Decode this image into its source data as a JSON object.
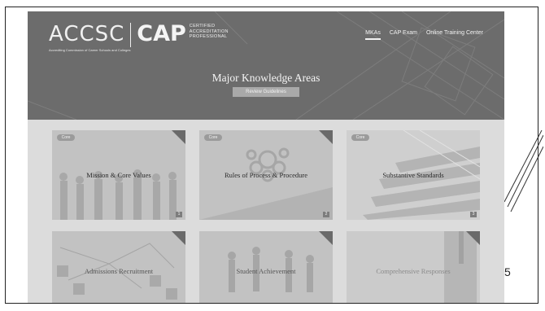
{
  "header": {
    "logo": {
      "accsc_text": "ACCSC",
      "accsc_subtitle": "Accrediting Commission of Career Schools and Colleges",
      "cap_text": "CAP",
      "cap_tagline_line1": "CERTIFIED",
      "cap_tagline_line2": "ACCREDITATION",
      "cap_tagline_line3": "PROFESSIONAL"
    },
    "nav": [
      "MKAs",
      "CAP Exam",
      "Online Training Center"
    ],
    "active_nav": "MKAs"
  },
  "hero": {
    "title": "Major Knowledge Areas",
    "button_label": "Review Guidelines"
  },
  "cards": [
    {
      "badge": "Core",
      "title": "Mission & Core Values",
      "number": "1"
    },
    {
      "badge": "Core",
      "title": "Rules of Process & Procedure",
      "number": "2"
    },
    {
      "badge": "Core",
      "title": "Substantive Standards",
      "number": "3"
    },
    {
      "badge": "",
      "title": "Admissions Recruitment",
      "number": ""
    },
    {
      "badge": "",
      "title": "Student Achievement",
      "number": ""
    },
    {
      "badge": "",
      "title": "Comprehensive Responses",
      "number": ""
    }
  ],
  "slide": {
    "page_number": "5"
  },
  "colors": {
    "header_bg": "#6c6c6c",
    "content_bg": "#dcdcdc",
    "card_bg": "#c2c2c2",
    "button_bg": "#a9a9a9"
  }
}
